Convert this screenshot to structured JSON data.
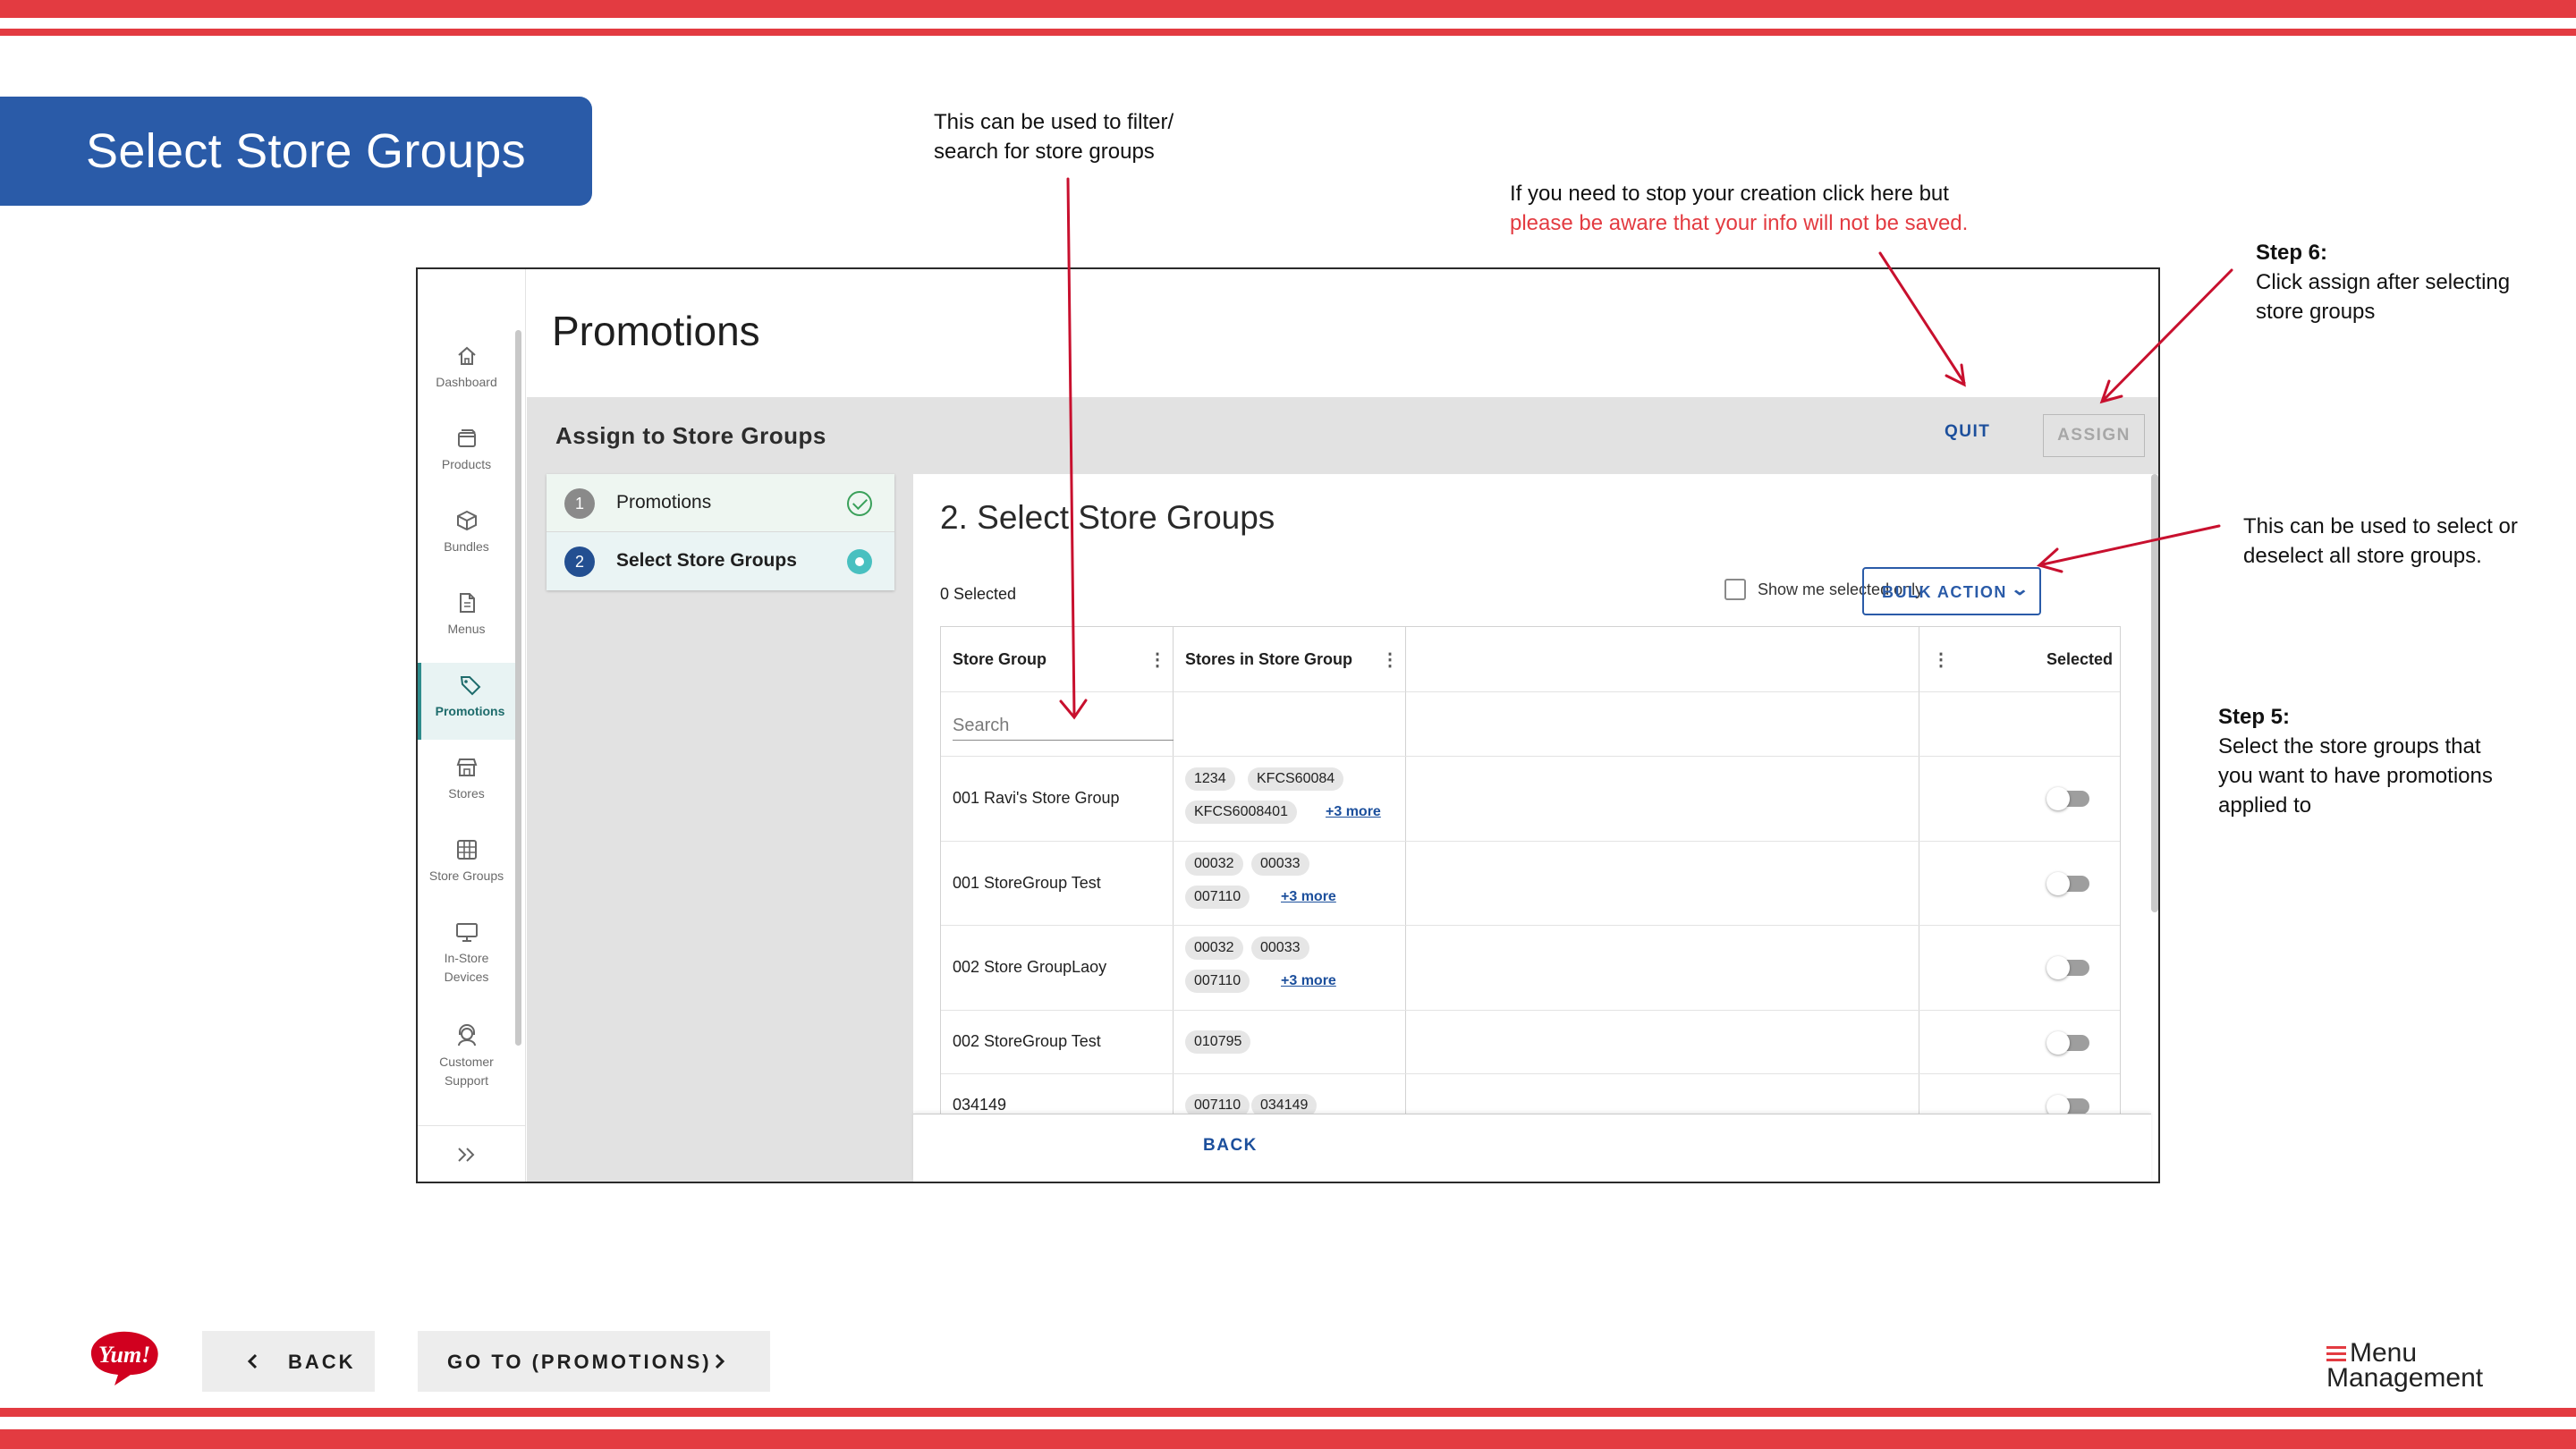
{
  "slide": {
    "title": "Select Store Groups",
    "notes": {
      "filter": [
        "This can be used to filter/",
        "search for store groups"
      ],
      "quit": [
        "If you need to stop your creation click here but",
        "please be aware that your info will not be saved."
      ],
      "step6_title": "Step 6:",
      "step6": [
        "Click assign after selecting",
        "store groups"
      ],
      "bulk": [
        "This can be used to select or",
        "deselect all store groups."
      ],
      "step5_title": "Step 5:",
      "step5": [
        "Select the store groups that",
        "you want to have promotions",
        "applied to"
      ]
    },
    "back_label": "BACK",
    "goto_label": "GO TO (PROMOTIONS)",
    "logo_text": "Yum!",
    "brand": [
      "Menu",
      "Management"
    ],
    "colors": {
      "accent_red": "#e33b41",
      "banner_blue": "#2a5ba8",
      "link_blue": "#1c4f9c",
      "active_teal": "#2e8c8c"
    }
  },
  "app": {
    "sidebar": [
      {
        "label": "Dashboard",
        "icon": "home-icon"
      },
      {
        "label": "Products",
        "icon": "box-icon"
      },
      {
        "label": "Bundles",
        "icon": "cube-icon"
      },
      {
        "label": "Menus",
        "icon": "document-icon"
      },
      {
        "label": "Promotions",
        "icon": "tag-icon",
        "active": true
      },
      {
        "label": "Stores",
        "icon": "storefront-icon"
      },
      {
        "label": "Store Groups",
        "icon": "grid-icon"
      },
      {
        "label": "In-Store Devices",
        "icon": "monitor-icon"
      },
      {
        "label": "Customer Support",
        "icon": "support-icon"
      }
    ],
    "page_title": "Promotions",
    "bar_title": "Assign to Store Groups",
    "quit": "QUIT",
    "assign": "ASSIGN",
    "steps": [
      {
        "num": "1",
        "label": "Promotions",
        "status": "complete"
      },
      {
        "num": "2",
        "label": "Select Store Groups",
        "status": "current"
      }
    ],
    "panel_title": "2. Select Store Groups",
    "selected_count": "0 Selected",
    "show_selected_label": "Show me selected only",
    "bulk_action": "BULK ACTION",
    "table": {
      "headers": [
        "Store Group",
        "Stores in Store Group",
        "",
        "Selected"
      ],
      "search_placeholder": "Search",
      "rows": [
        {
          "name": "001 Ravi's Store Group",
          "chips": [
            "1234",
            "KFCS60084",
            "KFCS6008401"
          ],
          "more": "+3 more",
          "selected": false
        },
        {
          "name": "001 StoreGroup Test",
          "chips": [
            "00032",
            "00033",
            "007110"
          ],
          "more": "+3 more",
          "selected": false
        },
        {
          "name": "002 Store GroupLaoy",
          "chips": [
            "00032",
            "00033",
            "007110"
          ],
          "more": "+3 more",
          "selected": false
        },
        {
          "name": "002 StoreGroup Test",
          "chips": [
            "010795"
          ],
          "more": "",
          "selected": false
        },
        {
          "name": "034149",
          "chips": [
            "007110",
            "034149"
          ],
          "more": "",
          "selected": false
        }
      ]
    },
    "footer_back": "BACK"
  }
}
